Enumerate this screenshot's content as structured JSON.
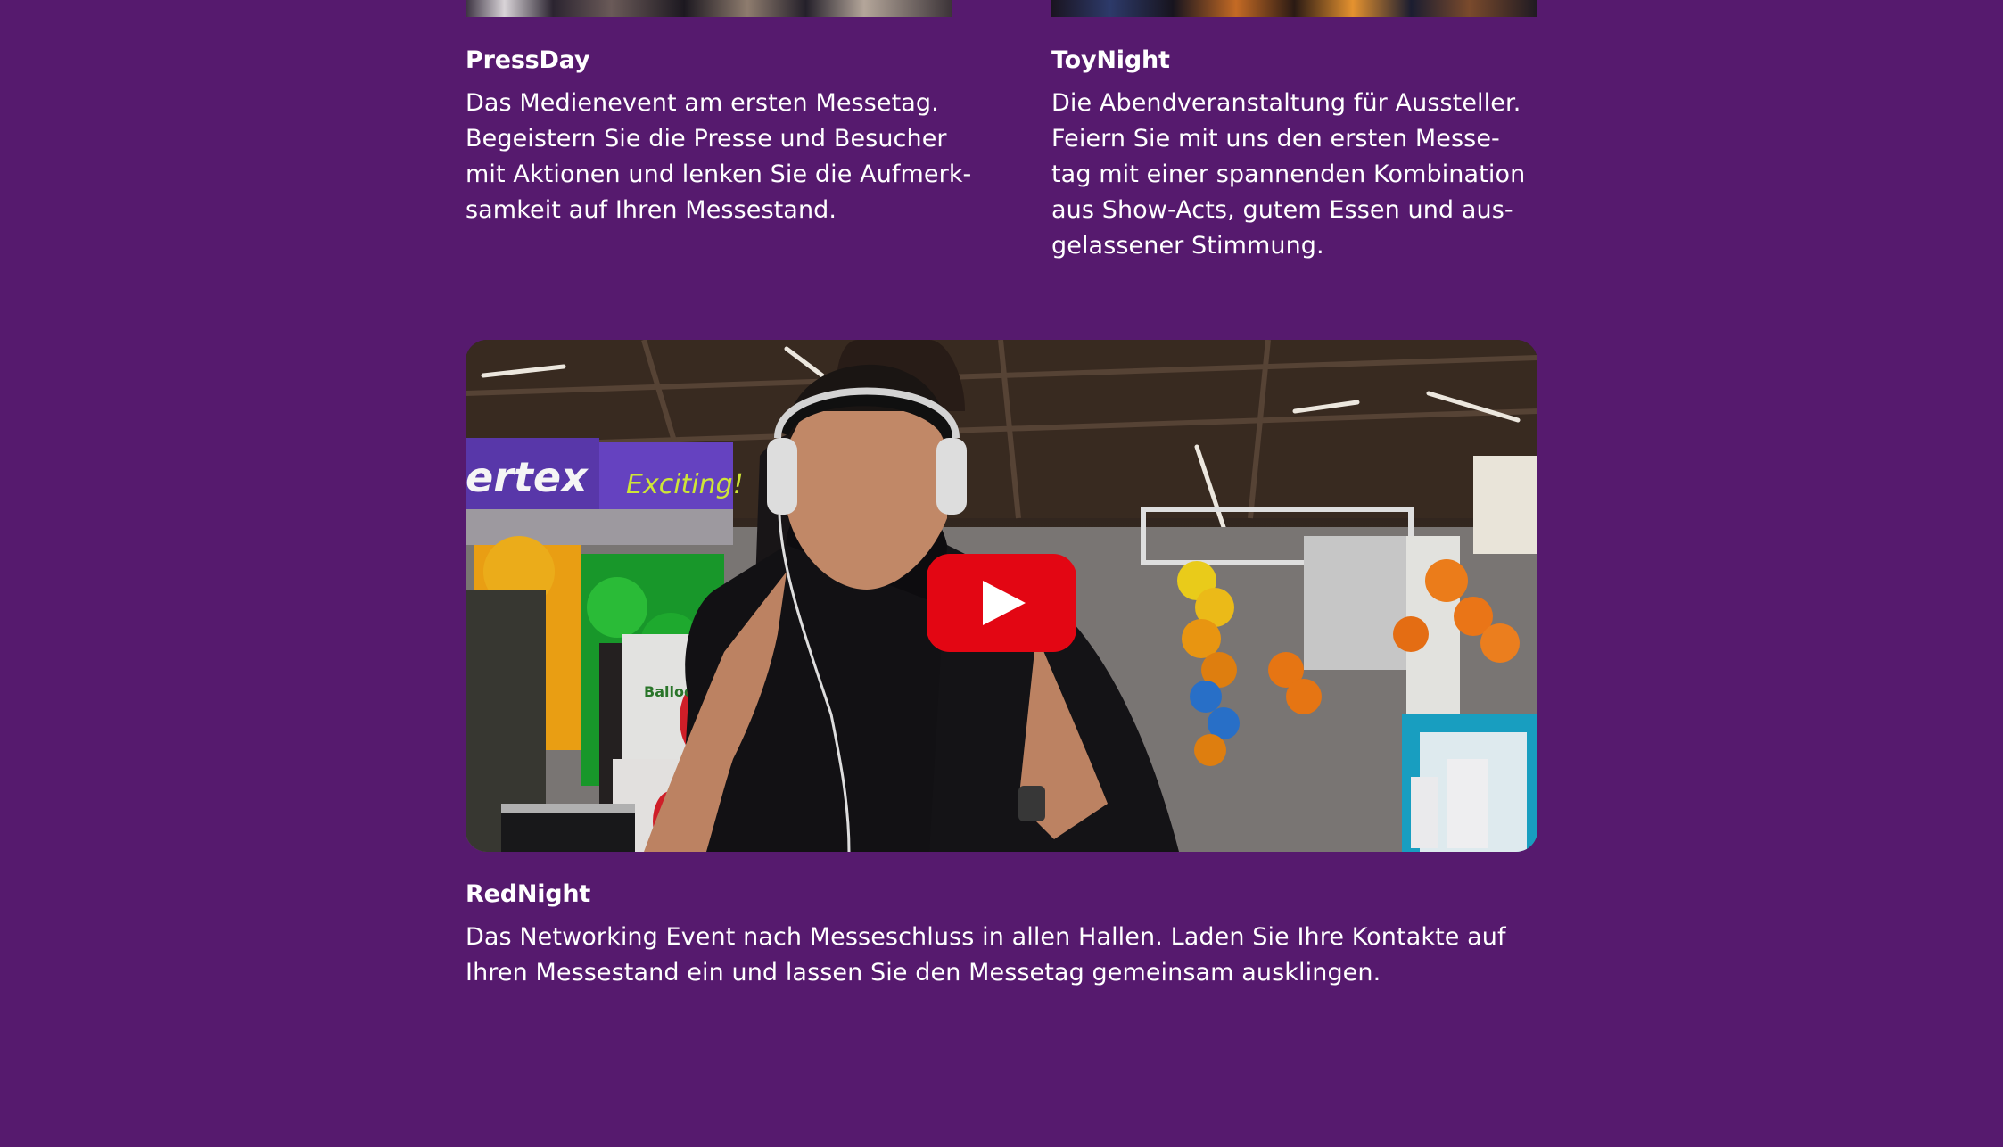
{
  "events": {
    "press_day": {
      "title": "PressDay",
      "lines": [
        "Das Medienevent am ersten Messetag.",
        "Begeistern Sie die Presse und Besucher",
        "mit Aktionen und lenken Sie die Aufmerk-",
        "samkeit auf Ihren Messestand."
      ]
    },
    "toy_night": {
      "title": "ToyNight",
      "lines": [
        "Die Abendveranstaltung für Aussteller.",
        "Feiern Sie mit uns den ersten Messe-",
        "tag mit einer spannenden Kombination",
        "aus Show-Acts, gutem Essen und aus-",
        "gelassener Stimmung."
      ]
    },
    "red_night": {
      "title": "RedNight",
      "lines": [
        "Das Networking Event nach Messeschluss in allen Hallen. Laden Sie Ihre Kontakte auf",
        "Ihren Messestand ein und lassen Sie den Messetag gemeinsam ausklingen."
      ]
    }
  },
  "video": {
    "banner_left": "ertex",
    "banner_right": "Exciting!",
    "box_label": "BalloonGas",
    "play_icon": "play-icon",
    "play_color": "#e30613"
  },
  "colors": {
    "background": "#561a6e",
    "text": "#ffffff"
  }
}
